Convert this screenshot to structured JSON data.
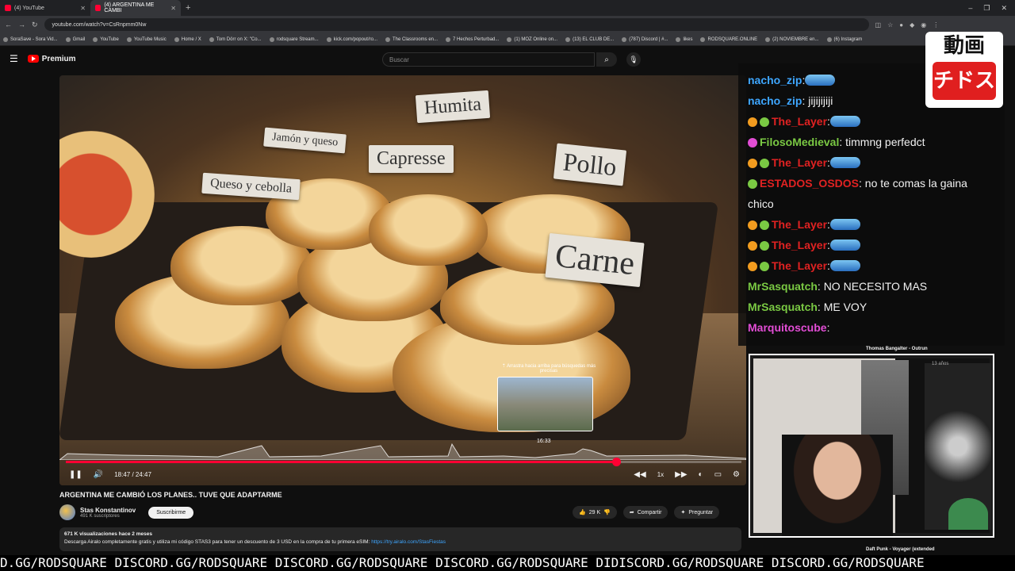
{
  "browser": {
    "tabs": [
      {
        "label": "(4) YouTube",
        "active": false
      },
      {
        "label": "(4) ARGENTINA ME CAMBI",
        "active": true
      }
    ],
    "new_tab": "+",
    "url": "youtube.com/watch?v=CsRnpmm0Nw",
    "window_controls": [
      "–",
      "❐",
      "✕"
    ],
    "bookmarks": [
      "SoraSave - Sora Vid...",
      "Gmail",
      "YouTube",
      "YouTube Music",
      "Home / X",
      "Tom Dörr on X: \"Co...",
      "rodsquare Stream...",
      "kick.com/popout/ro...",
      "The Classrooms en...",
      "7 Hechos Perturbad...",
      "(1) MOZ Online on...",
      "(13) EL CLUB DE...",
      "(787) Discord | #...",
      "likes",
      "RODSQUARE.ONLINE",
      "(2) NOVIEMBRE en...",
      "(6) Instagram"
    ]
  },
  "youtube": {
    "logo_label": "Premium",
    "search_placeholder": "Buscar",
    "search_icon": "⌕",
    "mic_icon": "🎙"
  },
  "video": {
    "labels": {
      "humita": "Humita",
      "jamon": "Jamón y queso",
      "capresse": "Capresse",
      "pollo": "Pollo",
      "queso": "Queso y cebolla",
      "carne": "Carne"
    },
    "preview_hint": "⇡ Arrastra hacia arriba para búsquedas más precisas",
    "preview_time": "16:33",
    "time": "18:47 / 24:47",
    "progress_fraction": 0.815,
    "speed": "1x",
    "title": "ARGENTINA ME CAMBIÓ LOS PLANES.. TUVE QUE ADAPTARME"
  },
  "channel": {
    "name": "Stas Konstantinov",
    "subs": "491 K suscriptores",
    "subscribe": "Suscribirme"
  },
  "actions": {
    "likes": "29 K",
    "share": "Compartir",
    "ask": "Preguntar"
  },
  "description": {
    "meta": "671 K visualizaciones  hace 2 meses",
    "text": "Descarga Airalo completamente gratis y utiliza mi código STAS3 para tener un descuento de 3 USD en la compra de tu primera eSIM: ",
    "link": "https://try.airalo.com/StasFiestas"
  },
  "chat": [
    {
      "user": "nacho_zip",
      "color": "#3ea6ff",
      "text": ":",
      "emote": true,
      "badges": []
    },
    {
      "user": "nacho_zip",
      "color": "#3ea6ff",
      "text": ": jijijijiji",
      "emote": false,
      "badges": []
    },
    {
      "user": "The_Layer",
      "color": "#e02222",
      "text": ":",
      "emote": true,
      "badges": [
        "#f29c1f",
        "#7ac943"
      ]
    },
    {
      "user": "FilosoMedieval",
      "color": "#7ac943",
      "text": ": timmng perfedct",
      "emote": false,
      "badges": [
        "#e24dd5"
      ]
    },
    {
      "user": "The_Layer",
      "color": "#e02222",
      "text": ":",
      "emote": true,
      "badges": [
        "#f29c1f",
        "#7ac943"
      ]
    },
    {
      "user": "ESTADOS_OSDOS",
      "color": "#e02222",
      "text": ": no te comas la gaina",
      "emote": false,
      "badges": [
        "#7ac943"
      ]
    },
    {
      "user": "",
      "color": "#fff",
      "text": "chico",
      "emote": false,
      "badges": []
    },
    {
      "user": "The_Layer",
      "color": "#e02222",
      "text": ":",
      "emote": true,
      "badges": [
        "#f29c1f",
        "#7ac943"
      ]
    },
    {
      "user": "The_Layer",
      "color": "#e02222",
      "text": ":",
      "emote": true,
      "badges": [
        "#f29c1f",
        "#7ac943"
      ]
    },
    {
      "user": "The_Layer",
      "color": "#e02222",
      "text": ":",
      "emote": true,
      "badges": [
        "#f29c1f",
        "#7ac943"
      ]
    },
    {
      "user": "MrSasquatch",
      "color": "#7ac943",
      "text": ": NO NECESITO MAS",
      "emote": false,
      "badges": []
    },
    {
      "user": "MrSasquatch",
      "color": "#7ac943",
      "text": ": ME VOY",
      "emote": false,
      "badges": []
    },
    {
      "user": "Marquitoscube",
      "color": "#e24dd5",
      "text": ":",
      "emote": false,
      "badges": []
    }
  ],
  "overlay": {
    "jp_top": "動画",
    "jp_bottom": "チドス",
    "cam_time": "13 años",
    "ghost_track1": "Thomas Bangalter - Outrun",
    "ghost_track2": "Daft Punk - Voyager (extended"
  },
  "ticker": "D.GG/RODSQUARE DISCORD.GG/RODSQUARE DISCORD.GG/RODSQUARE DISCORD.GG/RODSQUARE DIDISCORD.GG/RODSQUARE DISCORD.GG/RODSQUARE"
}
